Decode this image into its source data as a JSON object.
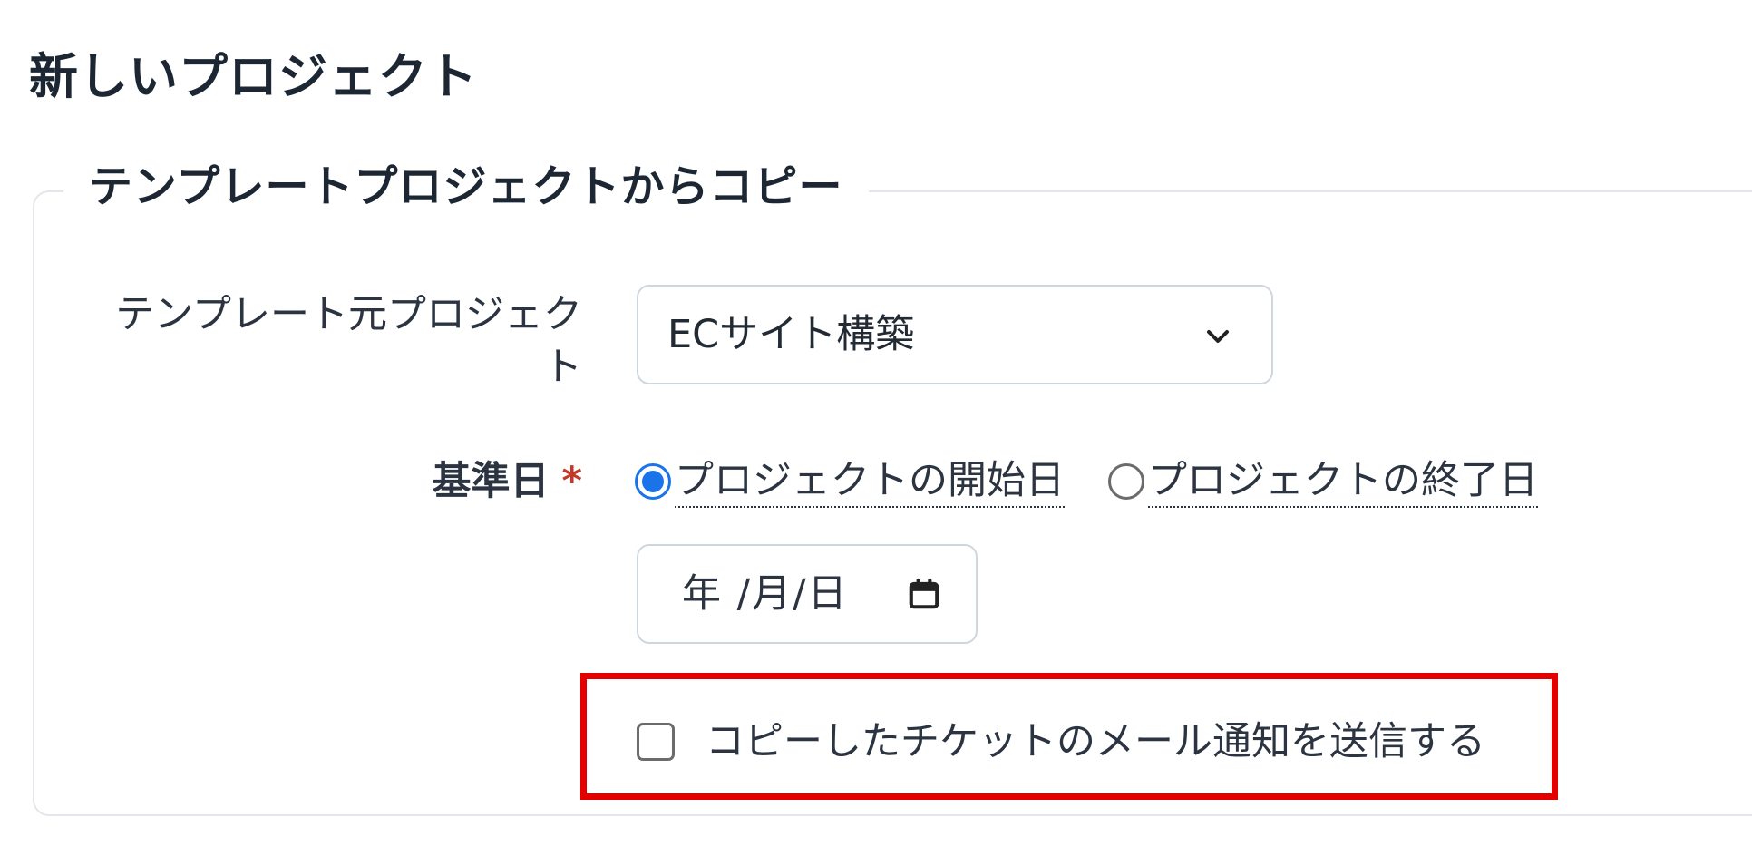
{
  "page": {
    "title": "新しいプロジェクト"
  },
  "copy_section": {
    "legend": "テンプレートプロジェクトからコピー",
    "template_label": "テンプレート元プロジェクト",
    "template_selected": "ECサイト構築",
    "base_date_label": "基準日",
    "required_mark": "*",
    "radio_options": [
      {
        "label": "プロジェクトの開始日",
        "checked": true
      },
      {
        "label": "プロジェクトの終了日",
        "checked": false
      }
    ],
    "date_placeholder": "年 /月/日",
    "notify_checkbox_label": "コピーしたチケットのメール通知を送信する",
    "notify_checked": false
  },
  "colors": {
    "highlight": "#e50000",
    "radio_accent": "#1a73e8",
    "required": "#c0392b"
  },
  "icons": {
    "select": "chevron-down-icon",
    "date": "calendar-icon"
  }
}
